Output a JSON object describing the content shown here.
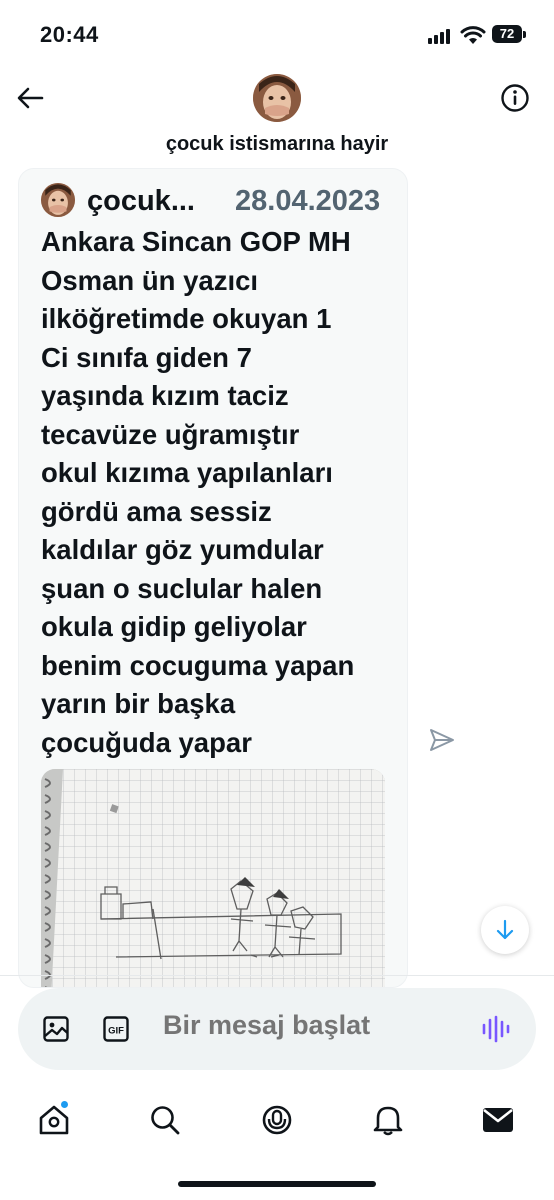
{
  "status_bar": {
    "time": "20:44",
    "battery": "72"
  },
  "header": {
    "title": "çocuk istismarına hayir",
    "back_icon": "arrow-left-icon",
    "info_icon": "info-circle-icon"
  },
  "message": {
    "author": "çocuk...",
    "date": "28.04.2023",
    "text": "Ankara Sincan GOP MH\nOsman ün yazıcı\nilköğretimde okuyan 1\nCi sınıfa giden 7\nyaşında kızım taciz\ntecavüze uğramıştır\nokul kızıma yapılanları\ngördü ama sessiz\nkaldılar göz yumdular\nşuan o suclular halen\nokula gidip geliyolar\nbenim cocuguma yapan\nyarın bir başka\nçocuğuda yapar",
    "attachment": "drawing-photo"
  },
  "composer": {
    "placeholder": "Bir mesaj başlat",
    "gif_label": "GIF"
  },
  "tabbar": {
    "items": [
      "home-icon",
      "search-icon",
      "spaces-icon",
      "notifications-icon",
      "messages-icon"
    ]
  },
  "colors": {
    "text": "#0f1419",
    "secondary": "#536471",
    "accent": "#1d9bf0",
    "voice": "#7856ff"
  }
}
